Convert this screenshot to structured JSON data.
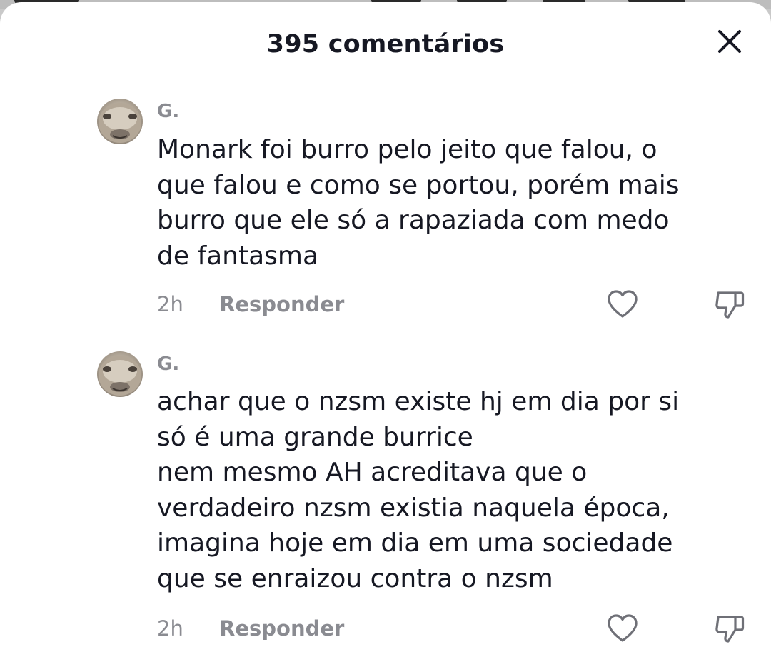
{
  "header": {
    "title": "395 comentários",
    "close_icon": "close-icon"
  },
  "comments": [
    {
      "author": "G.",
      "text": "Monark foi burro pelo jeito que falou, o\nque falou e como se portou, porém mais\nburro que ele só a rapaziada com medo\nde fantasma",
      "time": "2h",
      "reply_label": "Responder",
      "like_icon": "heart-outline-icon",
      "dislike_icon": "thumbs-down-icon"
    },
    {
      "author": "G.",
      "text": "achar que o nzsm existe hj em dia por si\nsó é uma grande burrice\nnem mesmo AH acreditava que o\nverdadeiro nzsm existia naquela época,\nimagina hoje em dia em uma sociedade\nque se enraizou contra o nzsm",
      "time": "2h",
      "reply_label": "Responder",
      "like_icon": "heart-outline-icon",
      "dislike_icon": "thumbs-down-icon"
    }
  ],
  "colors": {
    "text_primary": "#161823",
    "text_secondary": "#8a8b91",
    "sheet_background": "#ffffff",
    "backdrop": "#c9c9c9"
  }
}
